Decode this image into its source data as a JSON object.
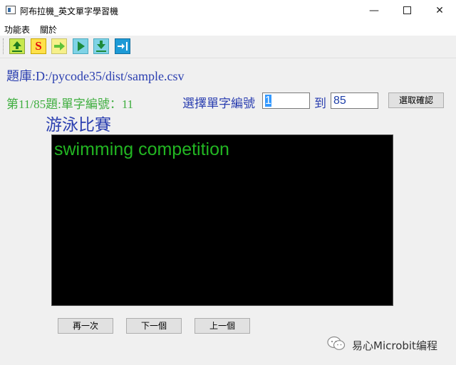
{
  "window": {
    "title": "阿布拉機_英文單字學習機",
    "min_glyph": "—",
    "close_glyph": "✕"
  },
  "menu": {
    "functions": "功能表",
    "about": "關於"
  },
  "toolbar": {
    "s_label": "S",
    "icons": [
      "upload-icon",
      "s-icon",
      "arrow-right-icon",
      "play-icon",
      "download-icon",
      "skip-end-icon"
    ]
  },
  "main": {
    "db_path": "題庫:D:/pycode35/dist/sample.csv",
    "status": "第11/85題:單字編號：11",
    "select_label": "選擇單字編號",
    "start_value": "1",
    "to_label": "到",
    "end_value": "85",
    "confirm_label": "選取確認",
    "chinese_word": "游泳比賽",
    "english_word": "swimming competition"
  },
  "buttons": {
    "again": "再一次",
    "next": "下一個",
    "previous": "上一個"
  },
  "watermark": {
    "text": "易心Microbit编程"
  },
  "colors": {
    "path_blue": "#2b3fb0",
    "status_green": "#3fae3f",
    "word_green": "#22b522",
    "display_bg": "#000000"
  }
}
